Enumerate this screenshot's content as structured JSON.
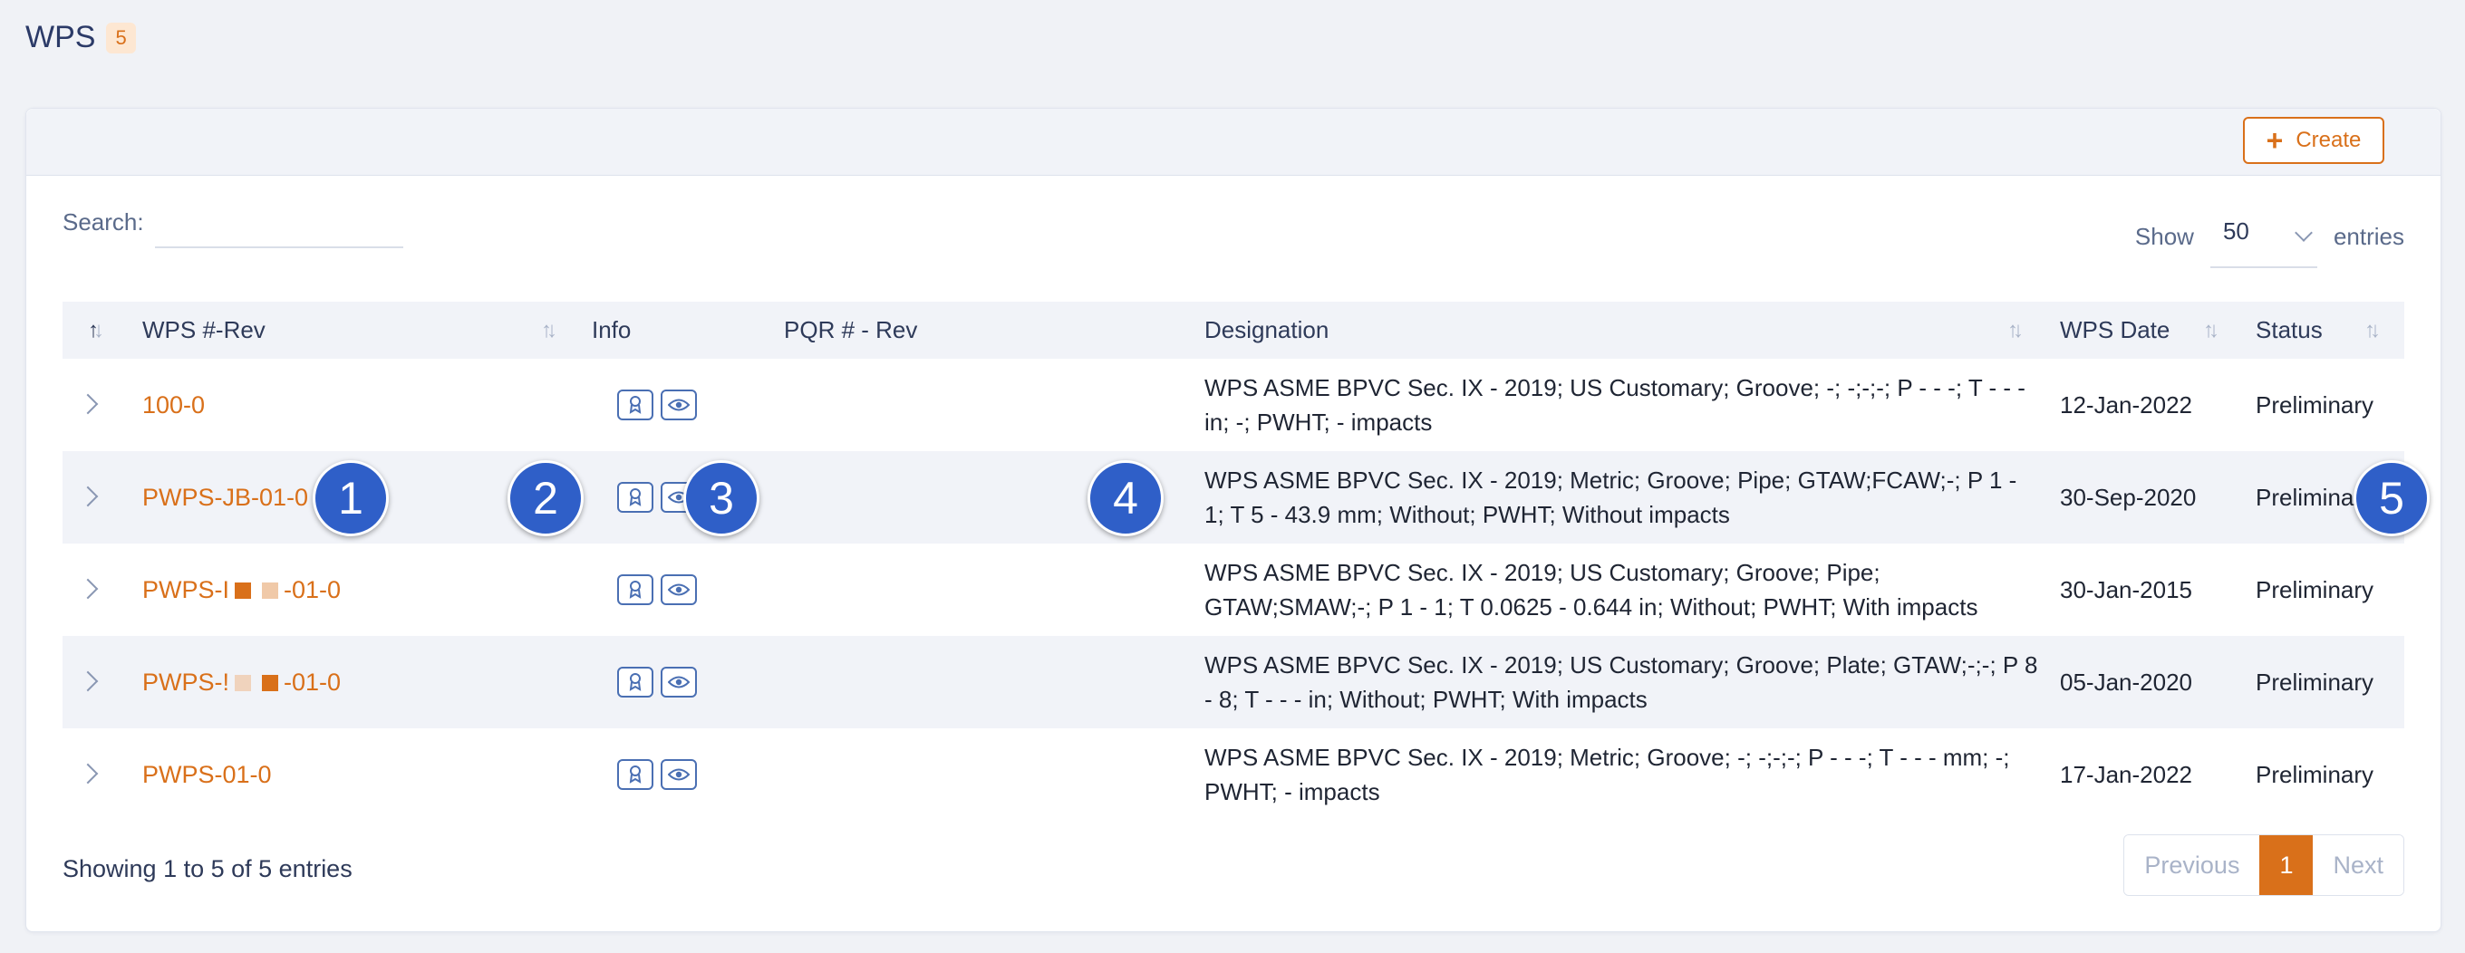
{
  "page": {
    "title": "WPS",
    "count": "5"
  },
  "toolbar": {
    "create_label": "Create"
  },
  "search": {
    "label": "Search:",
    "value": ""
  },
  "length": {
    "show_label": "Show",
    "selected": "50",
    "entries_label": "entries"
  },
  "columns": {
    "wps_rev": "WPS #-Rev",
    "info": "Info",
    "pqr_rev": "PQR # - Rev",
    "designation": "Designation",
    "wps_date": "WPS Date",
    "status": "Status"
  },
  "rows": [
    {
      "wps_prefix": "100-0",
      "wps_suffix": "",
      "designation": "WPS ASME BPVC Sec. IX - 2019; US Customary; Groove; -; -;-;-; P - - -; T - - - in; -; PWHT; - impacts",
      "date": "12-Jan-2022",
      "status": "Preliminary"
    },
    {
      "wps_prefix": "PWPS-JB-01-0",
      "wps_suffix": "",
      "designation": "WPS ASME BPVC Sec. IX - 2019; Metric; Groove; Pipe; GTAW;FCAW;-; P 1 - 1; T 5 - 43.9 mm; Without; PWHT; Without impacts",
      "date": "30-Sep-2020",
      "status": "Preliminary"
    },
    {
      "wps_prefix": "PWPS-I",
      "wps_suffix": "-01-0",
      "designation": "WPS ASME BPVC Sec. IX - 2019; US Customary; Groove; Pipe; GTAW;SMAW;-; P 1 - 1; T 0.0625 - 0.644 in; Without; PWHT; With impacts",
      "date": "30-Jan-2015",
      "status": "Preliminary"
    },
    {
      "wps_prefix": "PWPS-!",
      "wps_suffix": "-01-0",
      "designation": "WPS ASME BPVC Sec. IX - 2019; US Customary; Groove; Plate; GTAW;-;-; P 8 - 8; T - - - in; Without; PWHT; With impacts",
      "date": "05-Jan-2020",
      "status": "Preliminary"
    },
    {
      "wps_prefix": "PWPS-01-0",
      "wps_suffix": "",
      "designation": "WPS ASME BPVC Sec. IX - 2019; Metric; Groove; -; -;-;-; P - - -; T - - - mm; -; PWHT; - impacts",
      "date": "17-Jan-2022",
      "status": "Preliminary"
    }
  ],
  "footer": {
    "info": "Showing 1 to 5 of 5 entries"
  },
  "pagination": {
    "previous": "Previous",
    "current": "1",
    "next": "Next"
  },
  "markers": [
    "1",
    "2",
    "3",
    "4",
    "5"
  ],
  "icons": {
    "certificate": "certificate-icon",
    "view": "eye-icon",
    "expand": "chevron-right-icon",
    "sort": "sort-icon",
    "dropdown": "chevron-down-icon",
    "plus": "plus-icon"
  },
  "colors": {
    "accent": "#d9701a",
    "link": "#d9701a",
    "header_bg": "#f1f3f8",
    "marker": "#2f5fc8"
  }
}
